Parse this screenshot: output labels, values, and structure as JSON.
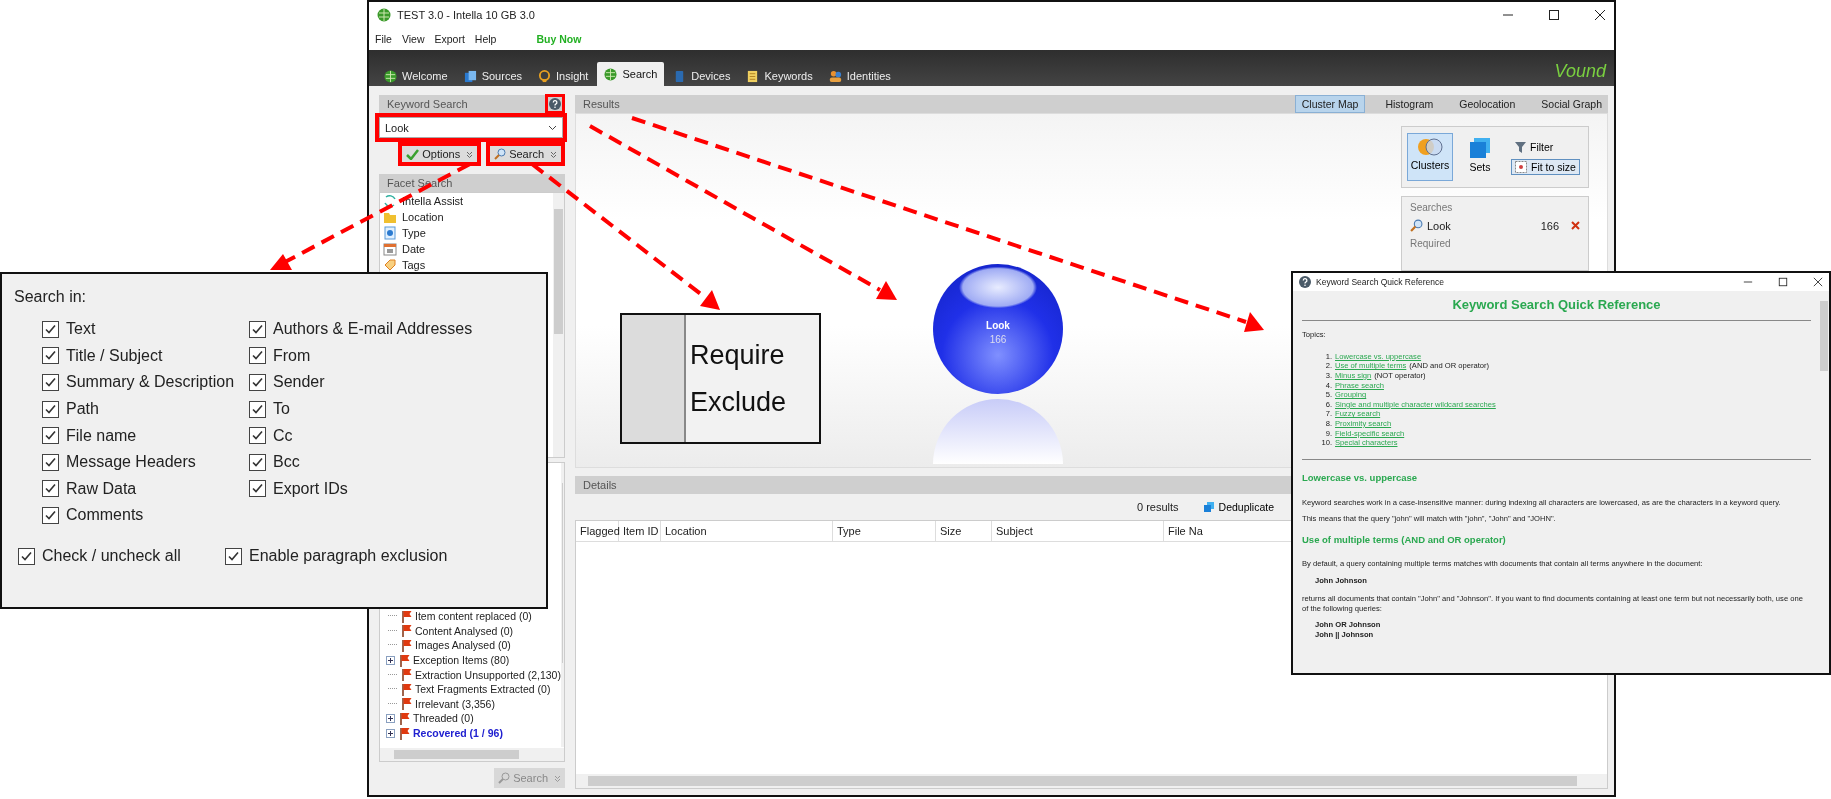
{
  "window": {
    "title": "TEST 3.0 - Intella 10 GB 3.0"
  },
  "menu": [
    "File",
    "View",
    "Export",
    "Help"
  ],
  "buy_now": "Buy Now",
  "tabs": [
    {
      "label": "Welcome",
      "selected": false
    },
    {
      "label": "Sources",
      "selected": false
    },
    {
      "label": "Insight",
      "selected": false
    },
    {
      "label": "Search",
      "selected": true
    },
    {
      "label": "Devices",
      "selected": false
    },
    {
      "label": "Keywords",
      "selected": false
    },
    {
      "label": "Identities",
      "selected": false
    }
  ],
  "brand": "Vound",
  "keyword_search": {
    "header": "Keyword Search",
    "query": "Look",
    "options_button": "Options",
    "search_button": "Search"
  },
  "facet_search": {
    "header": "Facet Search",
    "items": [
      {
        "label": "Intella Assist",
        "kind": "assist"
      },
      {
        "label": "Location",
        "kind": "folder"
      },
      {
        "label": "Type",
        "kind": "info"
      },
      {
        "label": "Date",
        "kind": "calendar"
      },
      {
        "label": "Tags",
        "kind": "tag"
      }
    ]
  },
  "facet_values": [
    {
      "label": "Item content replaced (0)",
      "expandable": false,
      "highlighted": false
    },
    {
      "label": "Content Analysed (0)",
      "expandable": false,
      "highlighted": false
    },
    {
      "label": "Images Analysed (0)",
      "expandable": false,
      "highlighted": false
    },
    {
      "label": "Exception Items (80)",
      "expandable": true,
      "highlighted": false
    },
    {
      "label": "Extraction Unsupported (2,130)",
      "expandable": false,
      "highlighted": false
    },
    {
      "label": "Text Fragments Extracted (0)",
      "expandable": false,
      "highlighted": false
    },
    {
      "label": "Irrelevant (3,356)",
      "expandable": false,
      "highlighted": false
    },
    {
      "label": "Threaded (0)",
      "expandable": true,
      "highlighted": false
    },
    {
      "label": "Recovered (1 / 96)",
      "expandable": true,
      "highlighted": true
    }
  ],
  "facet_search_button": "Search",
  "results": {
    "header": "Results",
    "views": [
      {
        "label": "Cluster Map",
        "selected": true
      },
      {
        "label": "Histogram",
        "selected": false
      },
      {
        "label": "Geolocation",
        "selected": false
      },
      {
        "label": "Social Graph",
        "selected": false
      }
    ],
    "tools": [
      {
        "label": "Clusters",
        "selected": true
      },
      {
        "label": "Sets",
        "selected": false
      }
    ],
    "filter": "Filter",
    "fit": {
      "label": "Fit to size",
      "on": true
    },
    "searches_header": "Searches",
    "searches": [
      {
        "term": "Look",
        "count": "166"
      }
    ],
    "required_header": "Required",
    "cluster": {
      "label": "Look",
      "count": "166"
    }
  },
  "details": {
    "header": "Details",
    "result_count": "0 results",
    "deduplicate": "Deduplicate",
    "columns": [
      "Flagged",
      "Item ID",
      "Location",
      "Type",
      "Size",
      "Subject",
      "File Na"
    ]
  },
  "options_popup": {
    "title": "Search in:",
    "left": [
      {
        "label": "Text",
        "checked": true
      },
      {
        "label": "Title / Subject",
        "checked": true
      },
      {
        "label": "Summary & Description",
        "checked": true
      },
      {
        "label": "Path",
        "checked": true
      },
      {
        "label": "File name",
        "checked": true
      },
      {
        "label": "Message Headers",
        "checked": true
      },
      {
        "label": "Raw Data",
        "checked": true
      },
      {
        "label": "Comments",
        "checked": true
      }
    ],
    "right": [
      {
        "label": "Authors & E-mail Addresses",
        "checked": true
      },
      {
        "label": "From",
        "checked": true
      },
      {
        "label": "Sender",
        "checked": true
      },
      {
        "label": "To",
        "checked": true
      },
      {
        "label": "Cc",
        "checked": true
      },
      {
        "label": "Bcc",
        "checked": true
      },
      {
        "label": "Export IDs",
        "checked": true
      }
    ],
    "footer": [
      {
        "label": "Check / uncheck all",
        "checked": true
      },
      {
        "label": "Enable paragraph exclusion",
        "checked": true
      }
    ]
  },
  "zoom_inset": [
    "Require",
    "Exclude"
  ],
  "quick_reference": {
    "title": "Keyword Search Quick Reference",
    "heading": "Keyword Search Quick Reference",
    "topics_label": "Topics:",
    "topics": [
      {
        "number": "1.",
        "link": "Lowercase vs. uppercase"
      },
      {
        "number": "2.",
        "link": "Use of multiple terms",
        "note": "(AND and OR operator)"
      },
      {
        "number": "3.",
        "link": "Minus sign",
        "note": "(NOT operator)"
      },
      {
        "number": "4.",
        "link": "Phrase search"
      },
      {
        "number": "5.",
        "link": "Grouping"
      },
      {
        "number": "6.",
        "link": "Single and multiple character wildcard searches"
      },
      {
        "number": "7.",
        "link": "Fuzzy search"
      },
      {
        "number": "8.",
        "link": "Proximity search"
      },
      {
        "number": "9.",
        "link": "Field-specific search"
      },
      {
        "number": "10.",
        "link": "Special characters"
      }
    ],
    "blocks": [
      {
        "kind": "heading",
        "text": "Lowercase vs. uppercase"
      },
      {
        "kind": "paragraph",
        "text": "Keyword searches work in a case-insensitive manner: during indexing all characters are lowercased, as are the characters in a keyword query."
      },
      {
        "kind": "paragraph",
        "text": "This means that the query \"john\" will match with \"john\", \"John\" and \"JOHN\"."
      },
      {
        "kind": "heading",
        "text": "Use of multiple terms (AND and OR operator)"
      },
      {
        "kind": "paragraph",
        "text": "By default, a query containing multiple terms matches with documents that contain all terms anywhere in the document:"
      },
      {
        "kind": "code",
        "text": "John Johnson"
      },
      {
        "kind": "paragraph",
        "text": "returns all documents that contain \"John\" and \"Johnson\". If you want to find documents containing at least one term but not necessarily both, use one of the following queries:"
      },
      {
        "kind": "code",
        "text": "John OR Johnson"
      },
      {
        "kind": "code",
        "text": "John || Johnson"
      }
    ]
  }
}
